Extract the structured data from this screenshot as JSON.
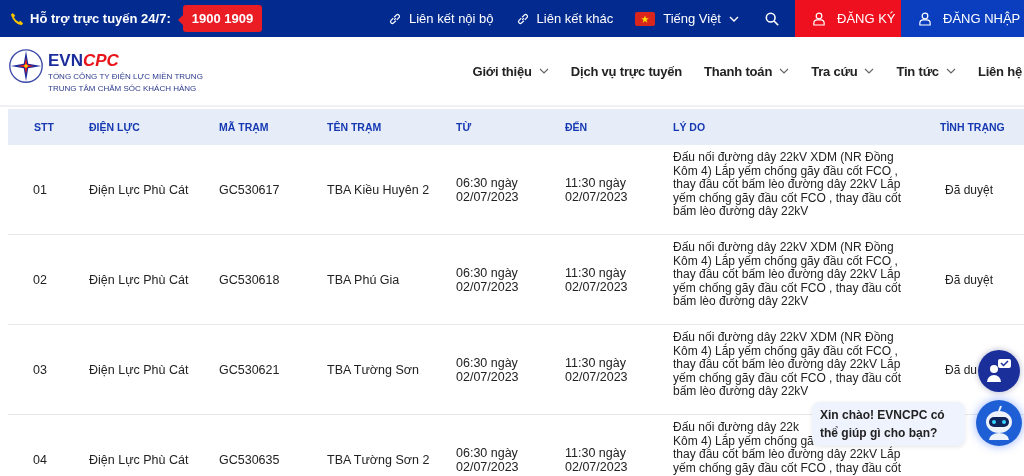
{
  "topbar": {
    "support_label": "Hỗ trợ trực tuyến 24/7:",
    "hotline": "1900 1909",
    "links": [
      {
        "label": "Liên kết nội bộ"
      },
      {
        "label": "Liên kết khác"
      }
    ],
    "language": "Tiếng Việt",
    "register": "ĐĂNG KÝ",
    "login": "ĐĂNG NHẬP"
  },
  "logo": {
    "brand_a": "EVN",
    "brand_b": "CPC",
    "line_1": "TỔNG CÔNG TY ĐIỆN LỰC MIỀN TRUNG",
    "line_2": "TRUNG TÂM CHĂM SÓC KHÁCH HÀNG"
  },
  "nav": [
    {
      "label": "Giới thiệu",
      "dropdown": true
    },
    {
      "label": "Dịch vụ trực tuyến",
      "dropdown": false
    },
    {
      "label": "Thanh toán",
      "dropdown": true
    },
    {
      "label": "Tra cứu",
      "dropdown": true
    },
    {
      "label": "Tin tức",
      "dropdown": true
    },
    {
      "label": "Liên hệ",
      "dropdown": false
    }
  ],
  "table": {
    "columns": [
      "STT",
      "ĐIỆN LỰC",
      "MÃ TRẠM",
      "TÊN TRẠM",
      "TỪ",
      "ĐẾN",
      "LÝ DO",
      "TÌNH TRẠNG"
    ],
    "rows": [
      {
        "stt": "01",
        "unit": "Điện Lực Phù Cát",
        "code": "GC530617",
        "station": "TBA Kiều Huyên 2",
        "from": "06:30 ngày 02/07/2023",
        "to": "11:30 ngày 02/07/2023",
        "reason_lines": [
          "Đấu nối đường dây 22kV XDM (NR Đồng",
          "Kôm 4) Lắp yếm chống gãy đầu cốt FCO ,",
          "thay đầu cốt bấm lèo đường dây 22kV Lắp",
          "yếm chống gãy đầu cốt FCO , thay đầu cốt",
          "bấm lèo đường dây 22kV"
        ],
        "status": "Đã duyệt"
      },
      {
        "stt": "02",
        "unit": "Điện Lực Phù Cát",
        "code": "GC530618",
        "station": "TBA Phú Gia",
        "from": "06:30 ngày 02/07/2023",
        "to": "11:30 ngày 02/07/2023",
        "reason_lines": [
          "Đấu nối đường dây 22kV XDM (NR Đồng",
          "Kôm 4) Lắp yếm chống gãy đầu cốt FCO ,",
          "thay đầu cốt bấm lèo đường dây 22kV Lắp",
          "yếm chống gãy đầu cốt FCO , thay đầu cốt",
          "bấm lèo đường dây 22kV"
        ],
        "status": "Đã duyệt"
      },
      {
        "stt": "03",
        "unit": "Điện Lực Phù Cát",
        "code": "GC530621",
        "station": "TBA Tường Sơn",
        "from": "06:30 ngày 02/07/2023",
        "to": "11:30 ngày 02/07/2023",
        "reason_lines": [
          "Đấu nối đường dây 22kV XDM (NR Đồng",
          "Kôm 4) Lắp yếm chống gãy đầu cốt FCO ,",
          "thay đầu cốt bấm lèo đường dây 22kV Lắp",
          "yếm chống gãy đầu cốt FCO , thay đầu cốt",
          "bấm lèo đường dây 22kV"
        ],
        "status": "Đã du"
      },
      {
        "stt": "04",
        "unit": "Điện Lực Phù Cát",
        "code": "GC530635",
        "station": "TBA Tường Sơn 2",
        "from": "06:30 ngày 02/07/2023",
        "to": "11:30 ngày 02/07/2023",
        "reason_lines": [
          "Đấu nối đường dây 22k",
          "Kôm 4) Lắp yếm chống gã",
          "thay đầu cốt bấm lèo đường dây 22kV Lắp",
          "yếm chống gãy đầu cốt FCO , thay đầu cốt"
        ]
      }
    ]
  },
  "chat": {
    "greeting": "Xin chào! EVNCPC có thể giúp gì cho bạn?"
  }
}
